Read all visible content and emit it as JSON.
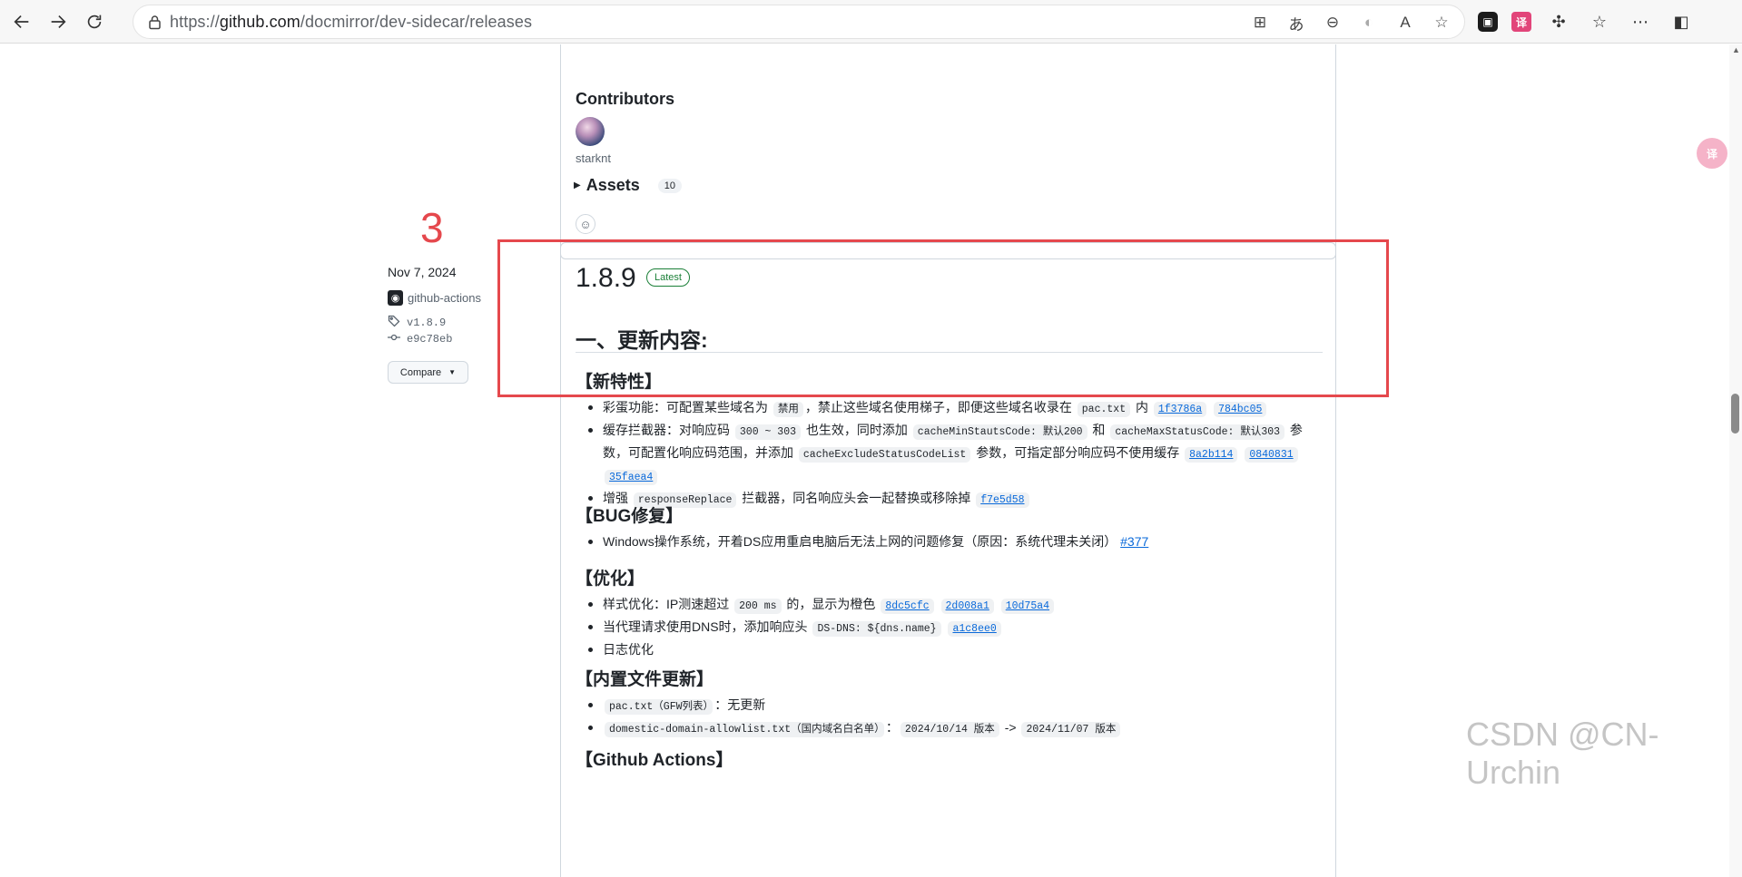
{
  "browser": {
    "url_scheme": "https://",
    "url_host": "github.com",
    "url_path": "/docmirror/dev-sidecar/releases"
  },
  "prev_release": {
    "contributors_title": "Contributors",
    "contributor_name": "starknt",
    "assets_label": "Assets",
    "assets_count": "10"
  },
  "annotation_number": "3",
  "release": {
    "date": "Nov 7, 2024",
    "author": "github-actions",
    "tag": "v1.8.9",
    "commit": "e9c78eb",
    "compare_label": "Compare",
    "title": "1.8.9",
    "latest_badge": "Latest",
    "section_title": "一、更新内容:",
    "features_title": "【新特性】",
    "features": {
      "f1_text_a": "彩蛋功能：可配置某些域名为 ",
      "f1_code1": "禁用",
      "f1_text_b": "，禁止这些域名使用梯子，即便这些域名收录在 ",
      "f1_code2": "pac.txt",
      "f1_text_c": " 内 ",
      "f1_sha1": "1f3786a",
      "f1_sha2": "784bc05",
      "f2_text_a": "缓存拦截器：对响应码 ",
      "f2_code1": "300 ~ 303",
      "f2_text_b": " 也生效，同时添加 ",
      "f2_code2": "cacheMinStautsCode: 默认200",
      "f2_text_c": " 和 ",
      "f2_code3": "cacheMaxStatusCode: 默认303",
      "f2_text_d": " 参数，可配置化响应码范围，并添加 ",
      "f2_code4": "cacheExcludeStatusCodeList",
      "f2_text_e": " 参数，可指定部分响应码不使用缓存 ",
      "f2_sha1": "8a2b114",
      "f2_sha2": "0840831",
      "f2_sha3": "35faea4",
      "f3_text_a": "增强 ",
      "f3_code1": "responseReplace",
      "f3_text_b": " 拦截器，同名响应头会一起替换或移除掉 ",
      "f3_sha1": "f7e5d58"
    },
    "bugfix_title": "【BUG修复】",
    "bugfix": {
      "b1_text": "Windows操作系统，开着DS应用重启电脑后无法上网的问题修复（原因：系统代理未关闭） ",
      "b1_issue": "#377"
    },
    "optimize_title": "【优化】",
    "optimize": {
      "o1_text_a": "样式优化：IP测速超过 ",
      "o1_code1": "200 ms",
      "o1_text_b": " 的，显示为橙色 ",
      "o1_sha1": "8dc5cfc",
      "o1_sha2": "2d008a1",
      "o1_sha3": "10d75a4",
      "o2_text_a": "当代理请求使用DNS时，添加响应头 ",
      "o2_code1": "DS-DNS: ${dns.name}",
      "o2_sha1": "a1c8ee0",
      "o3_text": "日志优化"
    },
    "builtin_title": "【内置文件更新】",
    "builtin": {
      "i1_code1": "pac.txt（GFW列表）",
      "i1_text": "：无更新",
      "i2_code1": "domestic-domain-allowlist.txt（国内域名白名单）",
      "i2_text_a": "：",
      "i2_code2": "2024/10/14 版本",
      "i2_text_b": " -> ",
      "i2_code3": "2024/11/07 版本"
    },
    "actions_title": "【Github Actions】"
  },
  "watermark": "CSDN @CN-Urchin",
  "colors": {
    "annotation_red": "#e5484d",
    "link_blue": "#0969da",
    "latest_green": "#1a7f37"
  }
}
